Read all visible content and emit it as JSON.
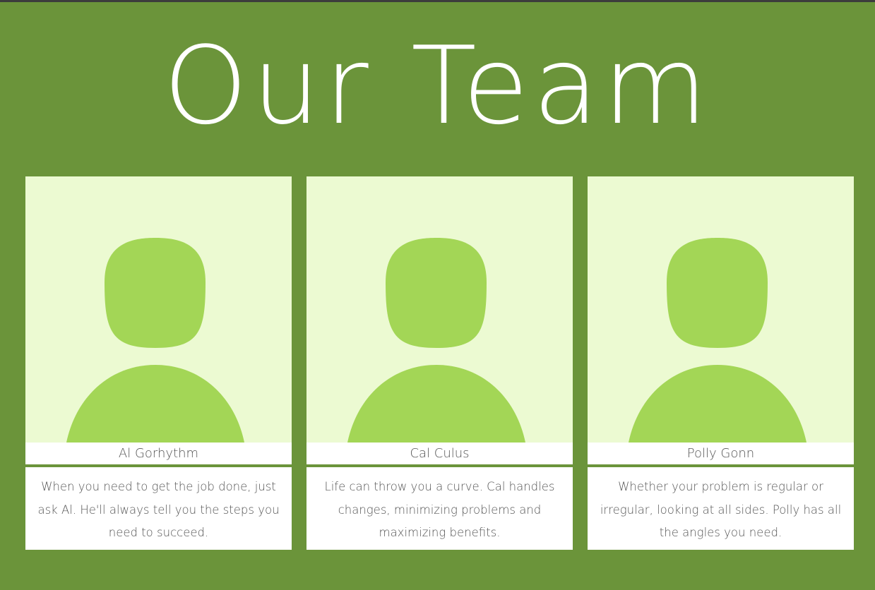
{
  "header": {
    "title": "Our Team"
  },
  "colors": {
    "background": "#6b943a",
    "photo_background": "#ecfad2",
    "avatar": "#a3d656",
    "text": "#555555"
  },
  "team": [
    {
      "name": "Al Gorhythm",
      "description": "When you need to get the job done, just ask Al. He'll always tell you the steps you need to succeed.",
      "avatar_icon": "person-placeholder-icon"
    },
    {
      "name": "Cal Culus",
      "description": "Life can throw you a curve. Cal handles changes, minimizing problems and maximizing benefits.",
      "avatar_icon": "person-placeholder-icon"
    },
    {
      "name": "Polly Gonn",
      "description": "Whether your problem is regular or irregular, looking at all sides. Polly has all the angles you need.",
      "avatar_icon": "person-placeholder-icon"
    }
  ]
}
